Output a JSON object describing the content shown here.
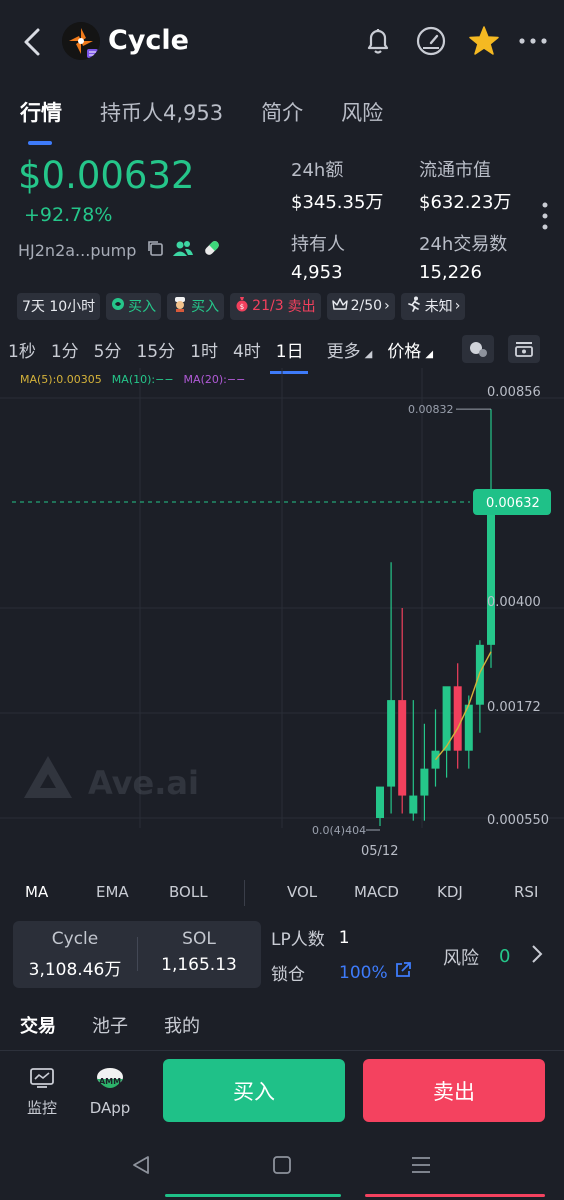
{
  "header": {
    "back_icon": "back-arrow-icon",
    "token_name": "Cycle",
    "icons": [
      "bell-icon",
      "gauge-icon",
      "star-icon",
      "more-icon"
    ],
    "star_color": "#f5b922"
  },
  "tabs": [
    {
      "label": "行情",
      "active": true
    },
    {
      "label": "持币人4,953",
      "active": false
    },
    {
      "label": "简介",
      "active": false
    },
    {
      "label": "风险",
      "active": false
    }
  ],
  "price": {
    "value": "$0.00632",
    "change": "+92.78%",
    "address": "HJ2n2a...pump"
  },
  "stats": [
    {
      "label": "24h额",
      "value": "$345.35万"
    },
    {
      "label": "流通市值",
      "value": "$632.23万"
    },
    {
      "label": "持有人",
      "value": "4,953"
    },
    {
      "label": "24h交易数",
      "value": "15,226"
    }
  ],
  "badges": [
    {
      "text": "7天 10小时",
      "icon": ""
    },
    {
      "text": "买入",
      "icon": "smart-money-icon",
      "color": "#25c68a"
    },
    {
      "text": "买入",
      "icon": "chef-icon",
      "color": "#25c68a"
    },
    {
      "text": "21/3",
      "text2": "卖出",
      "icon": "money-bag-icon",
      "color": "#f2405d"
    },
    {
      "text": "2/50",
      "icon": "crown-icon"
    },
    {
      "text": "未知",
      "icon": "runner-icon"
    }
  ],
  "timeframes": [
    {
      "label": "1秒",
      "active": false
    },
    {
      "label": "1分",
      "active": false
    },
    {
      "label": "5分",
      "active": false
    },
    {
      "label": "15分",
      "active": false
    },
    {
      "label": "1时",
      "active": false
    },
    {
      "label": "4时",
      "active": false
    },
    {
      "label": "1日",
      "active": true
    },
    {
      "label": "更多",
      "active": false
    },
    {
      "label": "价格",
      "active": false
    }
  ],
  "chart_data": {
    "type": "candlestick",
    "ma_legend": [
      {
        "label": "MA(5):0.00305",
        "color": "#d4b23a"
      },
      {
        "label": "MA(10):−−",
        "color": "#25c68a"
      },
      {
        "label": "MA(20):−−",
        "color": "#b05ad6"
      }
    ],
    "y_ticks": [
      "0.00856",
      "0.00400",
      "0.00172",
      "0.000550"
    ],
    "current_price": "0.00632",
    "high_label": "0.00832",
    "low_label": "0.0(4)404",
    "x_tick": "05/12",
    "watermark": "Ave.ai",
    "candles": [
      {
        "o": 0.00055,
        "h": 0.0006,
        "l": 0.0004,
        "c": 0.0009,
        "up": true
      },
      {
        "o": 0.0009,
        "h": 0.005,
        "l": 0.0006,
        "c": 0.002,
        "up": true
      },
      {
        "o": 0.002,
        "h": 0.004,
        "l": 0.0006,
        "c": 0.0008,
        "up": false
      },
      {
        "o": 0.0008,
        "h": 0.002,
        "l": 0.0005,
        "c": 0.0006,
        "up": true
      },
      {
        "o": 0.0008,
        "h": 0.0016,
        "l": 0.0005,
        "c": 0.0011,
        "up": true
      },
      {
        "o": 0.0011,
        "h": 0.0018,
        "l": 0.0009,
        "c": 0.0013,
        "up": true
      },
      {
        "o": 0.0013,
        "h": 0.0022,
        "l": 0.001,
        "c": 0.0023,
        "up": true
      },
      {
        "o": 0.0023,
        "h": 0.0028,
        "l": 0.0011,
        "c": 0.0013,
        "up": false
      },
      {
        "o": 0.0013,
        "h": 0.0021,
        "l": 0.0011,
        "c": 0.0019,
        "up": true
      },
      {
        "o": 0.0019,
        "h": 0.0033,
        "l": 0.0015,
        "c": 0.0032,
        "up": true
      },
      {
        "o": 0.0032,
        "h": 0.00832,
        "l": 0.0027,
        "c": 0.00632,
        "up": true
      }
    ],
    "ma5": [
      0.0012,
      0.00135,
      0.00155,
      0.0019,
      0.0026,
      0.00305
    ]
  },
  "indicators": [
    {
      "label": "MA",
      "active": true
    },
    {
      "label": "EMA",
      "active": false
    },
    {
      "label": "BOLL",
      "active": false
    },
    {
      "label": "VOL",
      "active": false
    },
    {
      "label": "MACD",
      "active": false
    },
    {
      "label": "KDJ",
      "active": false
    },
    {
      "label": "RSI",
      "active": false
    }
  ],
  "pool": {
    "token_label": "Cycle",
    "token_value": "3,108.46万",
    "sol_label": "SOL",
    "sol_value": "1,165.13",
    "lp_label": "LP人数",
    "lp_value": "1",
    "lock_label": "锁仓",
    "lock_value": "100%",
    "risk_label": "风险",
    "risk_value": "0"
  },
  "subtabs": [
    {
      "label": "交易",
      "active": true
    },
    {
      "label": "池子",
      "active": false
    },
    {
      "label": "我的",
      "active": false
    }
  ],
  "actionbar": {
    "monitor_label": "监控",
    "dapp_label": "DApp",
    "buy_label": "买入",
    "sell_label": "卖出"
  },
  "navbar": {
    "icons": [
      "nav-back-icon",
      "nav-home-icon",
      "nav-menu-icon"
    ]
  }
}
